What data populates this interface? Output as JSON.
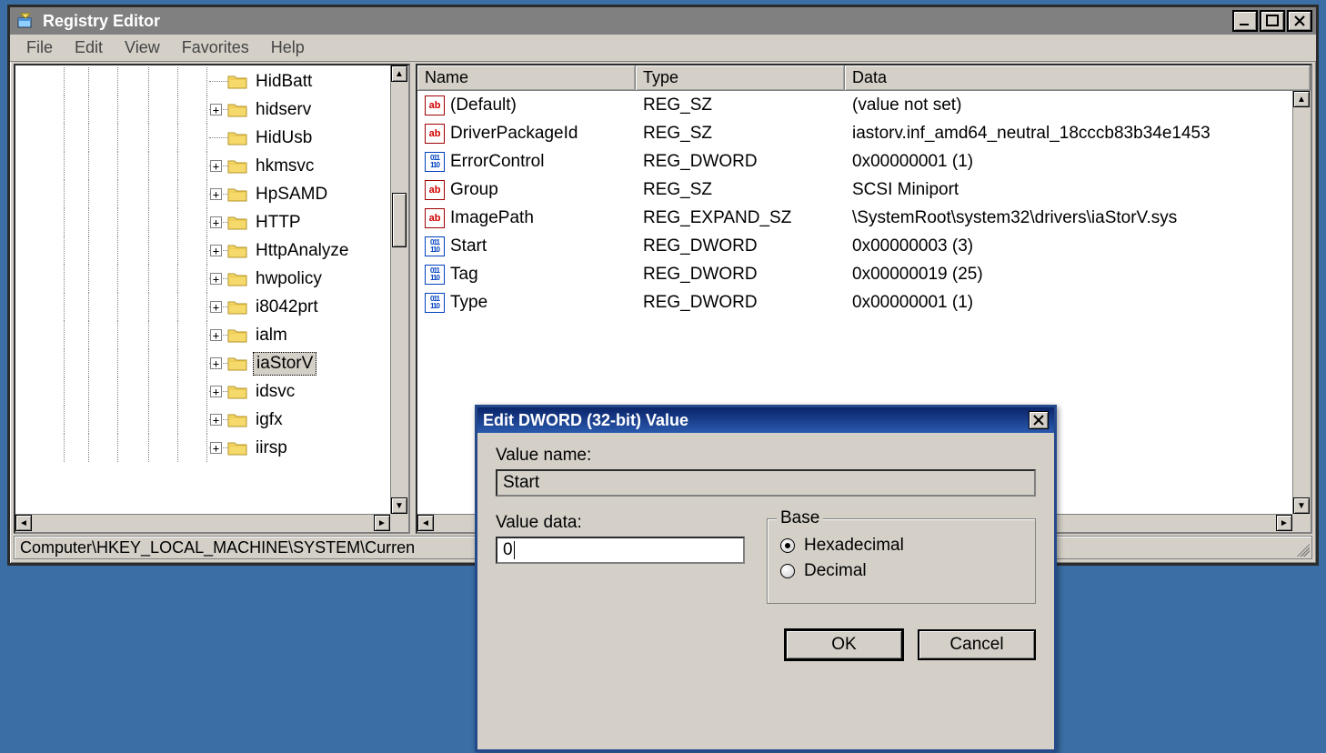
{
  "window": {
    "title": "Registry Editor"
  },
  "menu": {
    "file": "File",
    "edit": "Edit",
    "view": "View",
    "favorites": "Favorites",
    "help": "Help"
  },
  "tree": {
    "items": [
      {
        "label": "HidBatt",
        "expandable": false,
        "selected": false
      },
      {
        "label": "hidserv",
        "expandable": true,
        "selected": false
      },
      {
        "label": "HidUsb",
        "expandable": false,
        "selected": false
      },
      {
        "label": "hkmsvc",
        "expandable": true,
        "selected": false
      },
      {
        "label": "HpSAMD",
        "expandable": true,
        "selected": false
      },
      {
        "label": "HTTP",
        "expandable": true,
        "selected": false
      },
      {
        "label": "HttpAnalyze",
        "expandable": true,
        "selected": false
      },
      {
        "label": "hwpolicy",
        "expandable": true,
        "selected": false
      },
      {
        "label": "i8042prt",
        "expandable": true,
        "selected": false
      },
      {
        "label": "ialm",
        "expandable": true,
        "selected": false
      },
      {
        "label": "iaStorV",
        "expandable": true,
        "selected": true
      },
      {
        "label": "idsvc",
        "expandable": true,
        "selected": false
      },
      {
        "label": "igfx",
        "expandable": true,
        "selected": false
      },
      {
        "label": "iirsp",
        "expandable": true,
        "selected": false
      }
    ]
  },
  "list": {
    "columns": {
      "name": "Name",
      "type": "Type",
      "data": "Data"
    },
    "rows": [
      {
        "icon": "str",
        "name": "(Default)",
        "type": "REG_SZ",
        "data": "(value not set)"
      },
      {
        "icon": "str",
        "name": "DriverPackageId",
        "type": "REG_SZ",
        "data": "iastorv.inf_amd64_neutral_18cccb83b34e1453"
      },
      {
        "icon": "bin",
        "name": "ErrorControl",
        "type": "REG_DWORD",
        "data": "0x00000001 (1)"
      },
      {
        "icon": "str",
        "name": "Group",
        "type": "REG_SZ",
        "data": "SCSI Miniport"
      },
      {
        "icon": "str",
        "name": "ImagePath",
        "type": "REG_EXPAND_SZ",
        "data": "\\SystemRoot\\system32\\drivers\\iaStorV.sys"
      },
      {
        "icon": "bin",
        "name": "Start",
        "type": "REG_DWORD",
        "data": "0x00000003 (3)"
      },
      {
        "icon": "bin",
        "name": "Tag",
        "type": "REG_DWORD",
        "data": "0x00000019 (25)"
      },
      {
        "icon": "bin",
        "name": "Type",
        "type": "REG_DWORD",
        "data": "0x00000001 (1)"
      }
    ]
  },
  "statusbar": {
    "path": "Computer\\HKEY_LOCAL_MACHINE\\SYSTEM\\Curren"
  },
  "dialog": {
    "title": "Edit DWORD (32-bit) Value",
    "value_name_label": "Value name:",
    "value_name": "Start",
    "value_data_label": "Value data:",
    "value_data": "0",
    "base_label": "Base",
    "hex_label": "Hexadecimal",
    "dec_label": "Decimal",
    "base_selected": "hex",
    "ok": "OK",
    "cancel": "Cancel"
  }
}
